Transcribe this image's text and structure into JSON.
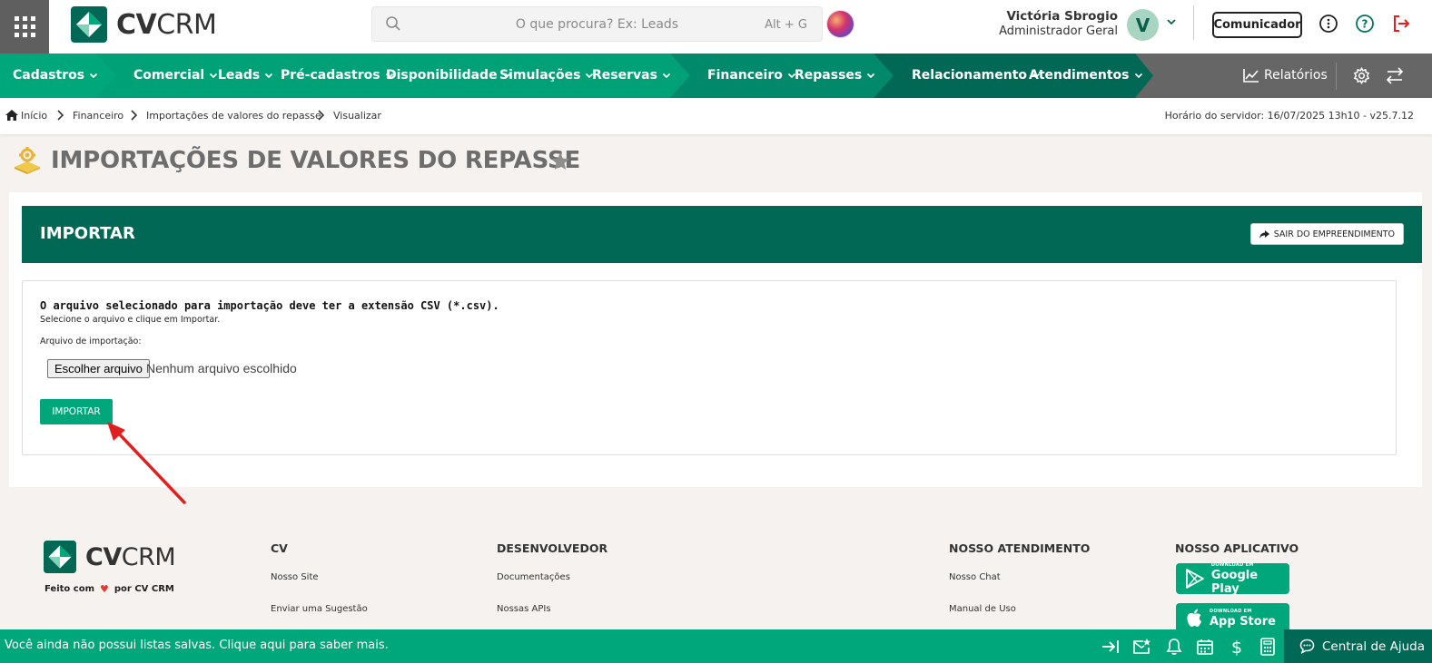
{
  "app": {
    "logo_text_bold": "CV",
    "logo_text_light": "CRM"
  },
  "search": {
    "placeholder": "O que procura? Ex: Leads",
    "shortcut": "Alt + G"
  },
  "user": {
    "name": "Victória Sbrogio",
    "role": "Administrador Geral",
    "avatar_letter": "V"
  },
  "header_buttons": {
    "comunicador": "Comunicador"
  },
  "nav": {
    "items": [
      {
        "label": "Cadastros"
      },
      {
        "label": "Comercial"
      },
      {
        "label": "Leads"
      },
      {
        "label": "Pré-cadastros"
      },
      {
        "label": "Disponibilidade"
      },
      {
        "label": "Simulações"
      },
      {
        "label": "Reservas"
      },
      {
        "label": "Financeiro"
      },
      {
        "label": "Repasses"
      },
      {
        "label": "Relacionamento"
      },
      {
        "label": "Atendimentos"
      }
    ],
    "reports_label": "Relatórios"
  },
  "breadcrumb": {
    "items": [
      "Início",
      "Financeiro",
      "Importações de valores do repasse",
      "Visualizar"
    ],
    "server_time": "Horário do servidor: 16/07/2025 13h10 - v25.7.12"
  },
  "page": {
    "title": "IMPORTAÇÕES DE VALORES DO REPASSE"
  },
  "import_section": {
    "header": "IMPORTAR",
    "exit_button": "SAIR DO EMPREENDIMENTO",
    "instruction_bold": "O arquivo selecionado para importação deve ter a extensão CSV (*.csv).",
    "instruction": "Selecione o arquivo e clique em Importar.",
    "file_label": "Arquivo de importação:",
    "choose_file_button": "Escolher arquivo",
    "no_file_text": "Nenhum arquivo escolhido",
    "import_button": "IMPORTAR"
  },
  "footer": {
    "made_with_prefix": "Feito com",
    "made_with_suffix": "por CV CRM",
    "columns": [
      {
        "title": "CV",
        "links": [
          "Nosso Site",
          "Enviar uma Sugestão"
        ]
      },
      {
        "title": "DESENVOLVEDOR",
        "links": [
          "Documentações",
          "Nossas APIs"
        ]
      },
      {
        "title": "NOSSO ATENDIMENTO",
        "links": [
          "Nosso Chat",
          "Manual de Uso"
        ]
      },
      {
        "title": "NOSSO APLICATIVO",
        "links": []
      }
    ],
    "stores": [
      {
        "top": "DOWNLOAD EM",
        "name": "Google Play"
      },
      {
        "top": "DOWNLOAD EM",
        "name": "App Store"
      }
    ]
  },
  "bottombar": {
    "message": "Você ainda não possui listas salvas. Clique aqui para saber mais.",
    "help_label": "Central de Ajuda"
  },
  "colors": {
    "primary_green": "#00a77a",
    "dark_green": "#006855",
    "nav_gray": "#666666",
    "annotation_arrow": "#e02020"
  }
}
